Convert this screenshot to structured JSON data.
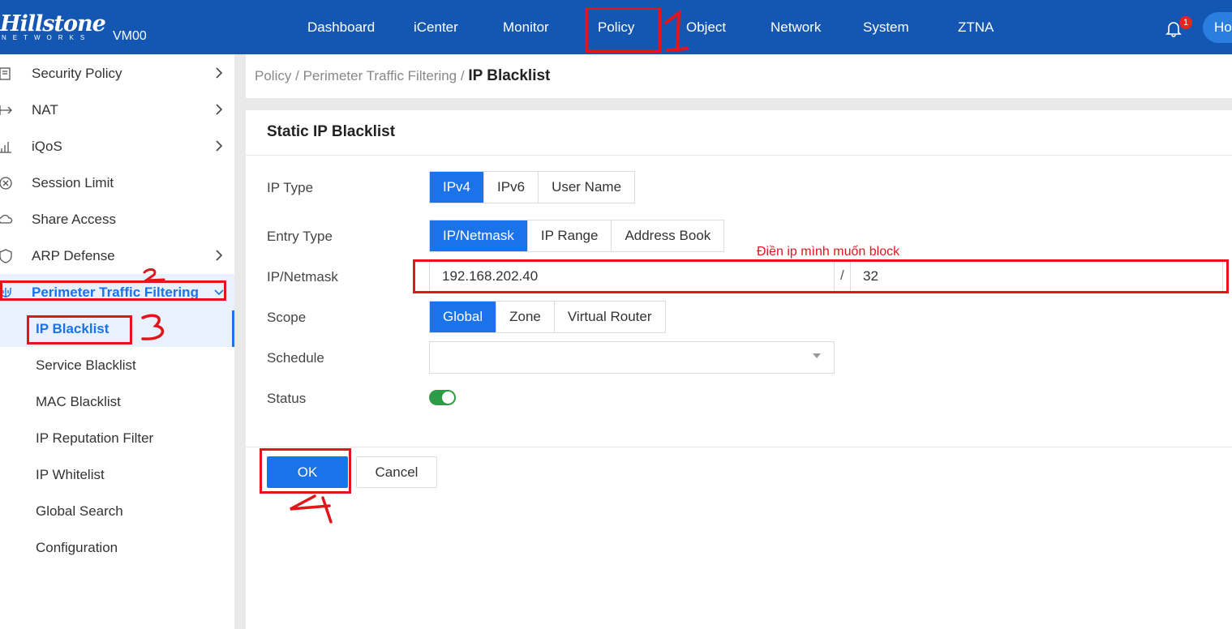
{
  "header": {
    "logo": "Hillstone",
    "logo_sub": "NETWORKS",
    "device_name": "VM00",
    "nav": [
      "Dashboard",
      "iCenter",
      "Monitor",
      "Policy",
      "Object",
      "Network",
      "System",
      "ZTNA"
    ],
    "notification_count": "1",
    "user_initials": "Ho"
  },
  "sidebar": {
    "items": [
      {
        "label": "Security Policy",
        "icon": "shield-list-icon"
      },
      {
        "label": "NAT",
        "icon": "arrow-in-icon"
      },
      {
        "label": "iQoS",
        "icon": "bar-chart-icon"
      },
      {
        "label": "Session Limit",
        "icon": "circle-x-icon"
      },
      {
        "label": "Share Access",
        "icon": "cloud-share-icon"
      },
      {
        "label": "ARP Defense",
        "icon": "arp-shield-icon"
      },
      {
        "label": "Perimeter Traffic Filtering",
        "icon": "filter-shield-icon"
      }
    ],
    "subitems": [
      "IP Blacklist",
      "Service Blacklist",
      "MAC Blacklist",
      "IP Reputation Filter",
      "IP Whitelist",
      "Global Search",
      "Configuration"
    ]
  },
  "breadcrumb": {
    "part1": "Policy",
    "part2": "Perimeter Traffic Filtering",
    "current": "IP Blacklist",
    "sep": "/"
  },
  "form": {
    "title": "Static IP Blacklist",
    "ip_type_label": "IP Type",
    "ip_type_options": [
      "IPv4",
      "IPv6",
      "User Name"
    ],
    "ip_type_selected": "IPv4",
    "entry_type_label": "Entry Type",
    "entry_type_options": [
      "IP/Netmask",
      "IP Range",
      "Address Book"
    ],
    "entry_type_selected": "IP/Netmask",
    "ip_netmask_label": "IP/Netmask",
    "ip_value": "192.168.202.40",
    "mask_sep": "/",
    "mask_value": "32",
    "scope_label": "Scope",
    "scope_options": [
      "Global",
      "Zone",
      "Virtual Router"
    ],
    "scope_selected": "Global",
    "schedule_label": "Schedule",
    "schedule_value": "",
    "status_label": "Status",
    "status_enabled": true,
    "ok_label": "OK",
    "cancel_label": "Cancel"
  },
  "annotations": {
    "note": "Điền ip mình muốn block",
    "color": "#e4141b",
    "step_numbers": [
      "1",
      "2",
      "3",
      "4"
    ]
  },
  "colors": {
    "header_bg": "#1457b3",
    "accent": "#1a73e8",
    "toggle_on": "#2e9c46",
    "annotation_red": "#e4141b"
  }
}
